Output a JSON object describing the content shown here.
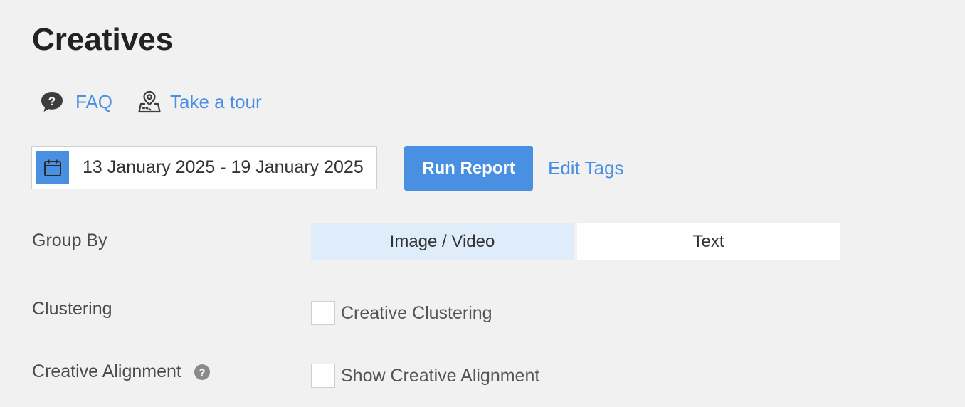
{
  "page": {
    "title": "Creatives"
  },
  "help": {
    "faq_label": "FAQ",
    "faq_icon": "question-bubble-icon",
    "tour_label": "Take a tour",
    "tour_icon": "map-pin-icon"
  },
  "toolbar": {
    "date_range": "13 January 2025 - 19 January 2025",
    "calendar_icon": "calendar-icon",
    "run_report_label": "Run Report",
    "edit_tags_label": "Edit Tags"
  },
  "group_by": {
    "label": "Group By",
    "options": [
      "Image / Video",
      "Text"
    ],
    "selected": "Image / Video"
  },
  "clustering": {
    "label": "Clustering",
    "checkbox_label": "Creative Clustering",
    "checked": false
  },
  "alignment": {
    "label": "Creative Alignment",
    "info_icon": "question-circle-icon",
    "checkbox_label": "Show Creative Alignment",
    "checked": false
  },
  "colors": {
    "accent": "#4a90e2",
    "background": "#f1f1f1",
    "segment_active": "#dfedfb"
  }
}
